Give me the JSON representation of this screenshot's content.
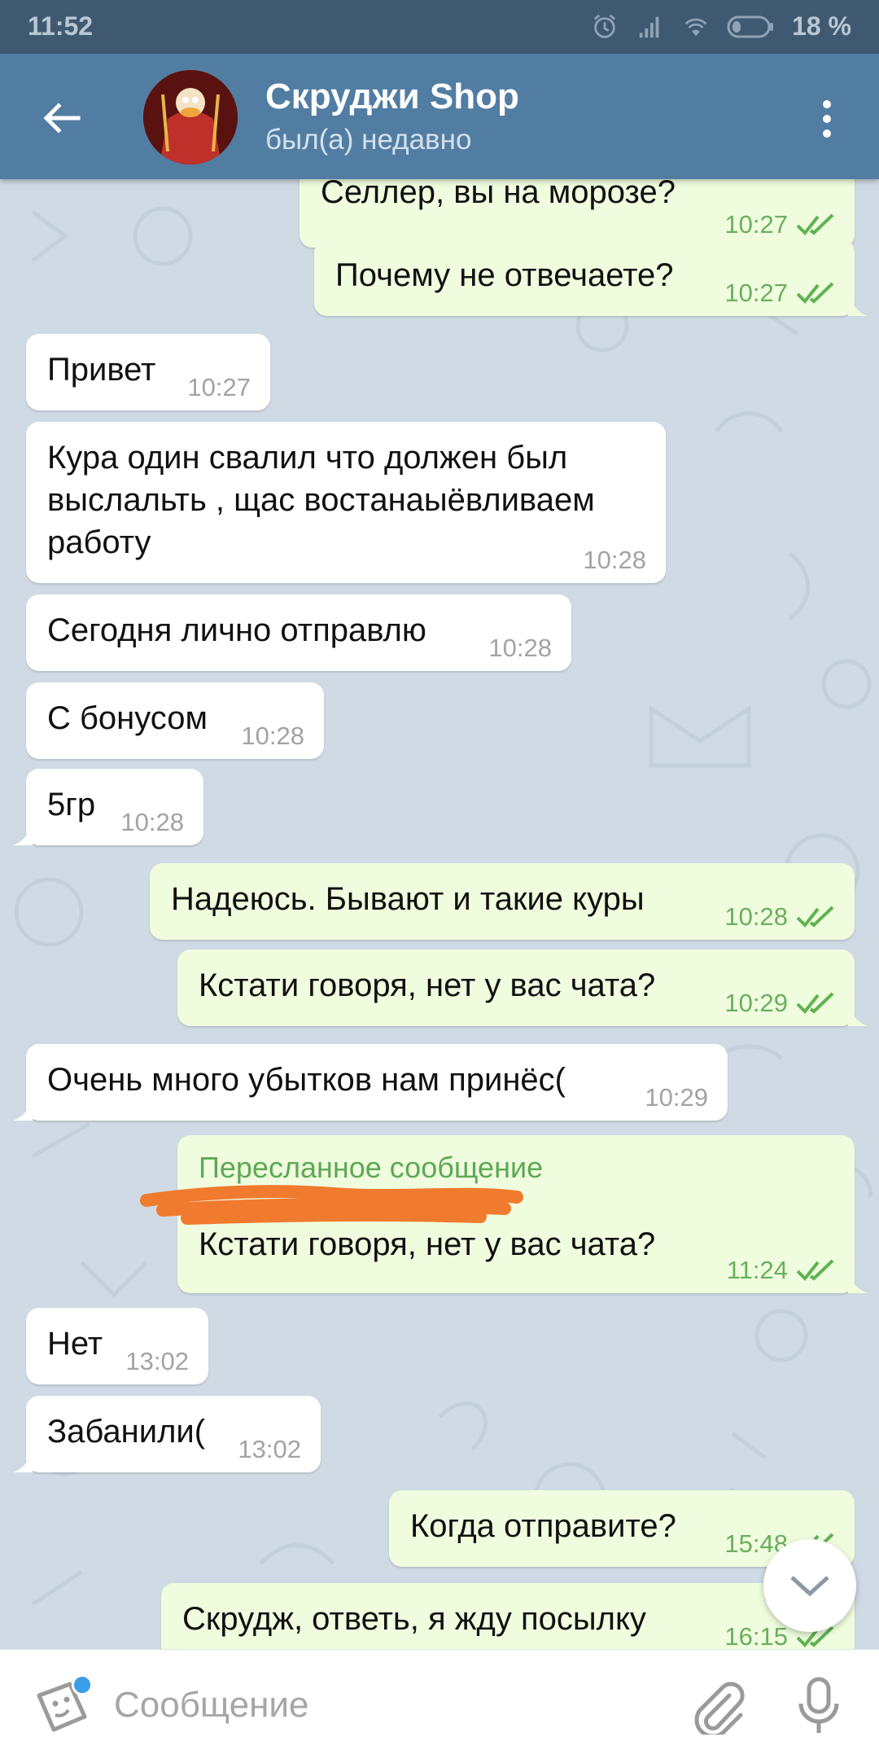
{
  "status_bar": {
    "time": "11:52",
    "battery": "18 %"
  },
  "header": {
    "title": "Скруджи Shop",
    "subtitle": "был(а) недавно"
  },
  "messages": [
    {
      "dir": "out",
      "text": "Селлер, вы на морозе?",
      "time": "10:27",
      "read": true
    },
    {
      "dir": "out",
      "text": "Почему не отвечаете?",
      "time": "10:27",
      "read": true
    },
    {
      "dir": "in",
      "text": "Привет",
      "time": "10:27"
    },
    {
      "dir": "in",
      "text": "Кура один свалил что должен был выслальть , щас востанаыёвливаем работу",
      "time": "10:28"
    },
    {
      "dir": "in",
      "text": "Сегодня лично отправлю",
      "time": "10:28"
    },
    {
      "dir": "in",
      "text": "С бонусом",
      "time": "10:28"
    },
    {
      "dir": "in",
      "text": "5гр",
      "time": "10:28"
    },
    {
      "dir": "out",
      "text": "Надеюсь. Бывают и такие куры",
      "time": "10:28",
      "read": true
    },
    {
      "dir": "out",
      "text": "Кстати говоря, нет у вас чата?",
      "time": "10:29",
      "read": true
    },
    {
      "dir": "in",
      "text": "Очень много убытков нам принёс(",
      "time": "10:29"
    },
    {
      "dir": "out",
      "forwarded_label": "Пересланное сообщение",
      "text": "Кстати говоря, нет у вас чата?",
      "time": "11:24",
      "read": true
    },
    {
      "dir": "in",
      "text": "Нет",
      "time": "13:02"
    },
    {
      "dir": "in",
      "text": "Забанили(",
      "time": "13:02"
    },
    {
      "dir": "out",
      "text": "Когда отправите?",
      "time": "15:48",
      "read": true
    },
    {
      "dir": "out",
      "text": "Скрудж, ответь, я жду посылку",
      "time": "16:15",
      "read": true
    }
  ],
  "input": {
    "placeholder": "Сообщение"
  },
  "colors": {
    "header": "#527da3",
    "status_bar": "#3f5a70",
    "chat_background": "#cfdae4",
    "outgoing_bubble": "#effdde",
    "incoming_bubble": "#ffffff",
    "read_check": "#5fb351",
    "forward_label": "#5fa854",
    "redaction": "#f07b2e"
  },
  "icons": [
    "back-arrow-icon",
    "more-vert-icon",
    "double-check-icon",
    "chevron-down-icon",
    "sticker-icon",
    "attach-icon",
    "mic-icon",
    "alarm-icon",
    "signal-icon",
    "wifi-icon",
    "battery-icon"
  ]
}
